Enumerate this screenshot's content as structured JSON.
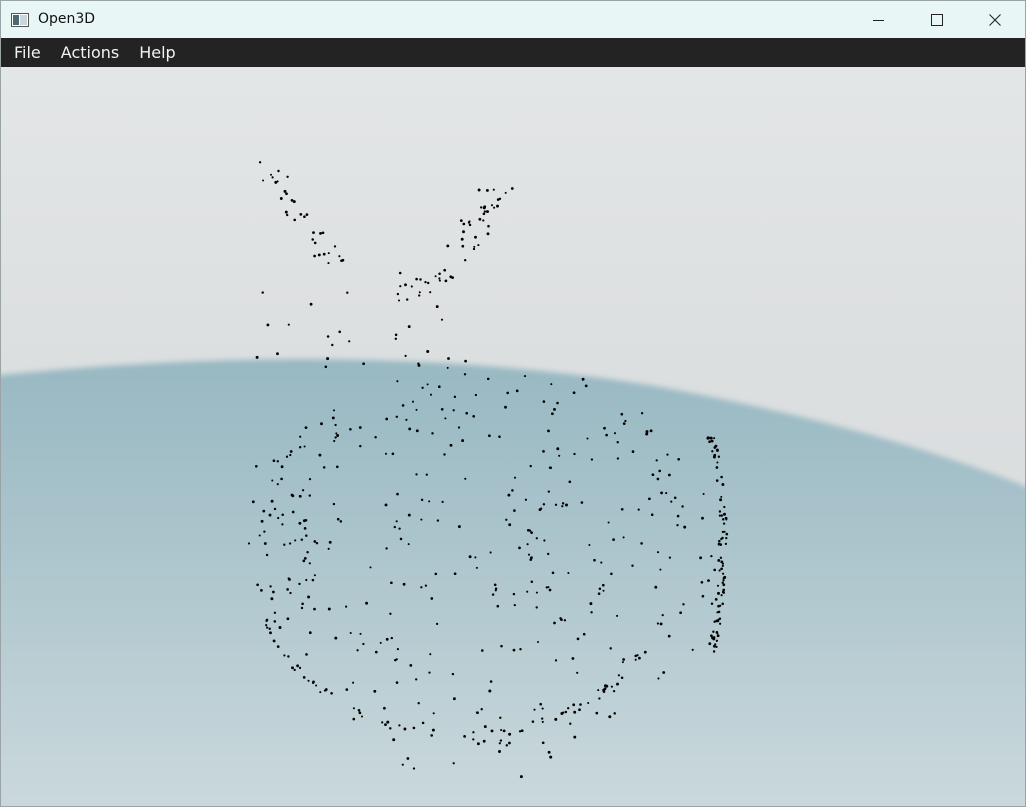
{
  "window": {
    "title": "Open3D",
    "icon": "open3d-app-icon",
    "controls": [
      "minimize-icon",
      "maximize-icon",
      "close-icon"
    ]
  },
  "menubar": {
    "items": [
      {
        "label": "File"
      },
      {
        "label": "Actions"
      },
      {
        "label": "Help"
      }
    ]
  },
  "scene": {
    "content": "point-cloud",
    "background_top": "#e3e6e7",
    "ground_color": "#a9c3cb",
    "point_color": "#000000"
  }
}
